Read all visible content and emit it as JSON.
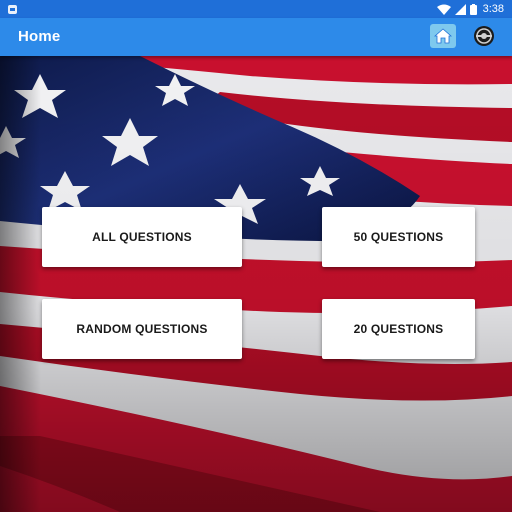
{
  "status_bar": {
    "time": "3:38",
    "icons": [
      "notification-icon",
      "wifi-icon",
      "signal-icon",
      "battery-icon"
    ]
  },
  "app_bar": {
    "title": "Home",
    "actions": [
      "home-icon",
      "settings-icon"
    ],
    "color": "#2d8ae9"
  },
  "background": {
    "image": "american-flag"
  },
  "buttons": {
    "all": "ALL QUESTIONS",
    "fifty": "50 QUESTIONS",
    "random": "RANDOM QUESTIONS",
    "twenty": "20 QUESTIONS"
  }
}
